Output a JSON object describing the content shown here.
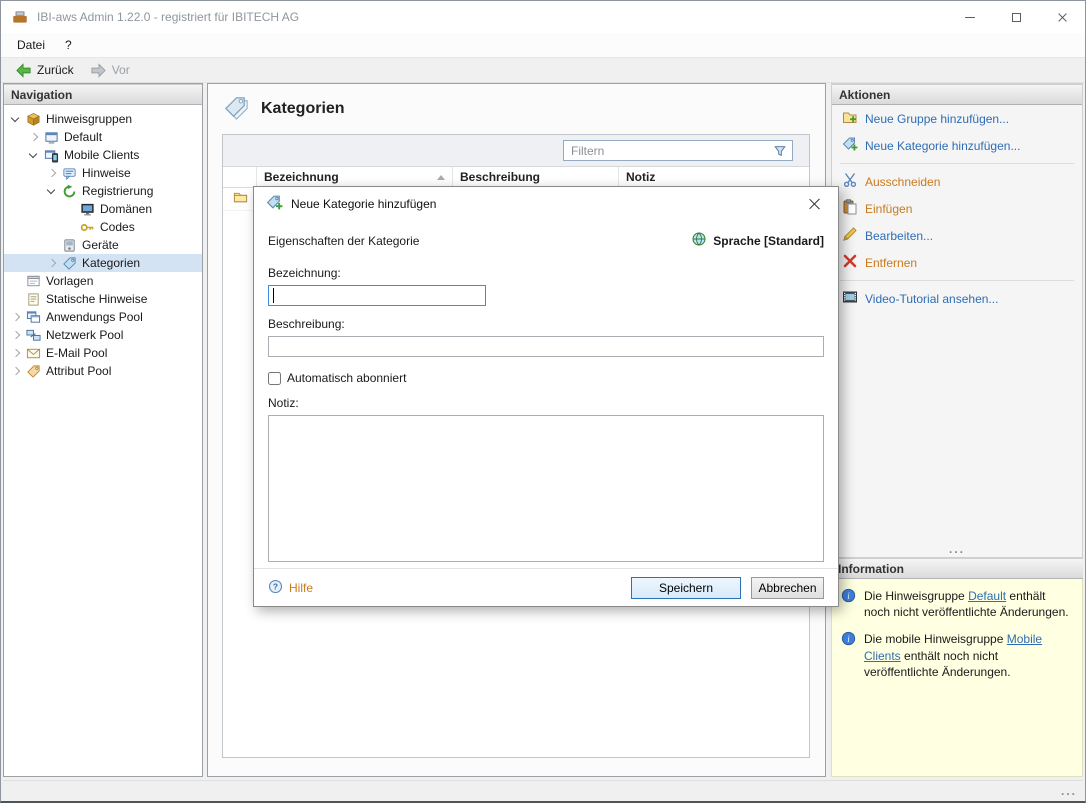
{
  "window": {
    "title": "IBI-aws Admin 1.22.0 - registriert für IBITECH AG"
  },
  "menubar": {
    "items": [
      {
        "label": "Datei"
      },
      {
        "label": "?"
      }
    ]
  },
  "toolbar": {
    "back": "Zurück",
    "forward": "Vor"
  },
  "navigation": {
    "header": "Navigation",
    "tree": [
      {
        "label": "Hinweisgruppen",
        "level": 0,
        "state": "expanded",
        "icon": "group-box-icon"
      },
      {
        "label": "Default",
        "level": 1,
        "state": "collapsed",
        "icon": "client-icon"
      },
      {
        "label": "Mobile Clients",
        "level": 1,
        "state": "expanded",
        "icon": "mobile-client-icon"
      },
      {
        "label": "Hinweise",
        "level": 2,
        "state": "collapsed",
        "icon": "hint-icon"
      },
      {
        "label": "Registrierung",
        "level": 2,
        "state": "expanded",
        "icon": "registration-icon"
      },
      {
        "label": "Domänen",
        "level": 3,
        "state": "leaf",
        "icon": "domain-icon"
      },
      {
        "label": "Codes",
        "level": 3,
        "state": "leaf",
        "icon": "key-icon"
      },
      {
        "label": "Geräte",
        "level": 2,
        "state": "leaf",
        "icon": "device-icon"
      },
      {
        "label": "Kategorien",
        "level": 2,
        "state": "collapsed",
        "icon": "category-tag-icon",
        "selected": true
      },
      {
        "label": "Vorlagen",
        "level": 0,
        "state": "leaf",
        "icon": "template-icon"
      },
      {
        "label": "Statische Hinweise",
        "level": 0,
        "state": "leaf",
        "icon": "static-hint-icon"
      },
      {
        "label": "Anwendungs Pool",
        "level": 0,
        "state": "collapsed",
        "icon": "app-pool-icon"
      },
      {
        "label": "Netzwerk Pool",
        "level": 0,
        "state": "collapsed",
        "icon": "network-pool-icon"
      },
      {
        "label": "E-Mail Pool",
        "level": 0,
        "state": "collapsed",
        "icon": "email-pool-icon"
      },
      {
        "label": "Attribut Pool",
        "level": 0,
        "state": "collapsed",
        "icon": "attribute-pool-icon"
      }
    ]
  },
  "main": {
    "title": "Kategorien",
    "filter_placeholder": "Filtern",
    "table": {
      "columns": [
        "Bezeichnung",
        "Beschreibung",
        "Notiz"
      ],
      "sort": {
        "column": "Bezeichnung",
        "direction": "asc"
      },
      "rows": [
        {
          "icon": "folder-icon"
        }
      ]
    }
  },
  "actions": {
    "header": "Aktionen",
    "items": [
      {
        "label": "Neue Gruppe hinzufügen...",
        "color": "blue",
        "icon": "add-group-icon"
      },
      {
        "label": "Neue Kategorie hinzufügen...",
        "color": "blue",
        "icon": "add-category-icon"
      },
      {
        "label": "Ausschneiden",
        "color": "orange",
        "icon": "cut-icon"
      },
      {
        "label": "Einfügen",
        "color": "orange",
        "icon": "paste-icon"
      },
      {
        "label": "Bearbeiten...",
        "color": "blue",
        "icon": "edit-icon"
      },
      {
        "label": "Entfernen",
        "color": "orange",
        "icon": "remove-icon"
      },
      {
        "label": "Video-Tutorial ansehen...",
        "color": "blue",
        "icon": "video-icon"
      }
    ],
    "overflow": "..."
  },
  "information": {
    "header": "Information",
    "items": [
      {
        "prefix": "Die Hinweisgruppe ",
        "link": "Default",
        "suffix": " enthält noch nicht veröffentlichte Änderungen."
      },
      {
        "prefix": "Die mobile Hinweisgruppe ",
        "link": "Mobile Clients",
        "suffix": " enthält noch nicht veröffentlichte Änderungen."
      }
    ]
  },
  "dialog": {
    "title": "Neue Kategorie hinzufügen",
    "section_label": "Eigenschaften der Kategorie",
    "language_label": "Sprache [Standard]",
    "fields": {
      "bezeichnung_label": "Bezeichnung:",
      "bezeichnung_value": "",
      "beschreibung_label": "Beschreibung:",
      "beschreibung_value": "",
      "checkbox_label": "Automatisch abonniert",
      "checkbox_checked": false,
      "notiz_label": "Notiz:",
      "notiz_value": ""
    },
    "help_label": "Hilfe",
    "save_label": "Speichern",
    "cancel_label": "Abbrechen"
  },
  "statusbar": {
    "grip": "..."
  },
  "colors": {
    "link_blue": "#2e6db5",
    "action_orange": "#c97a1e",
    "info_bg": "#ffffe1",
    "selected_bg": "#d3e3f3",
    "accent": "#2a72b5"
  }
}
